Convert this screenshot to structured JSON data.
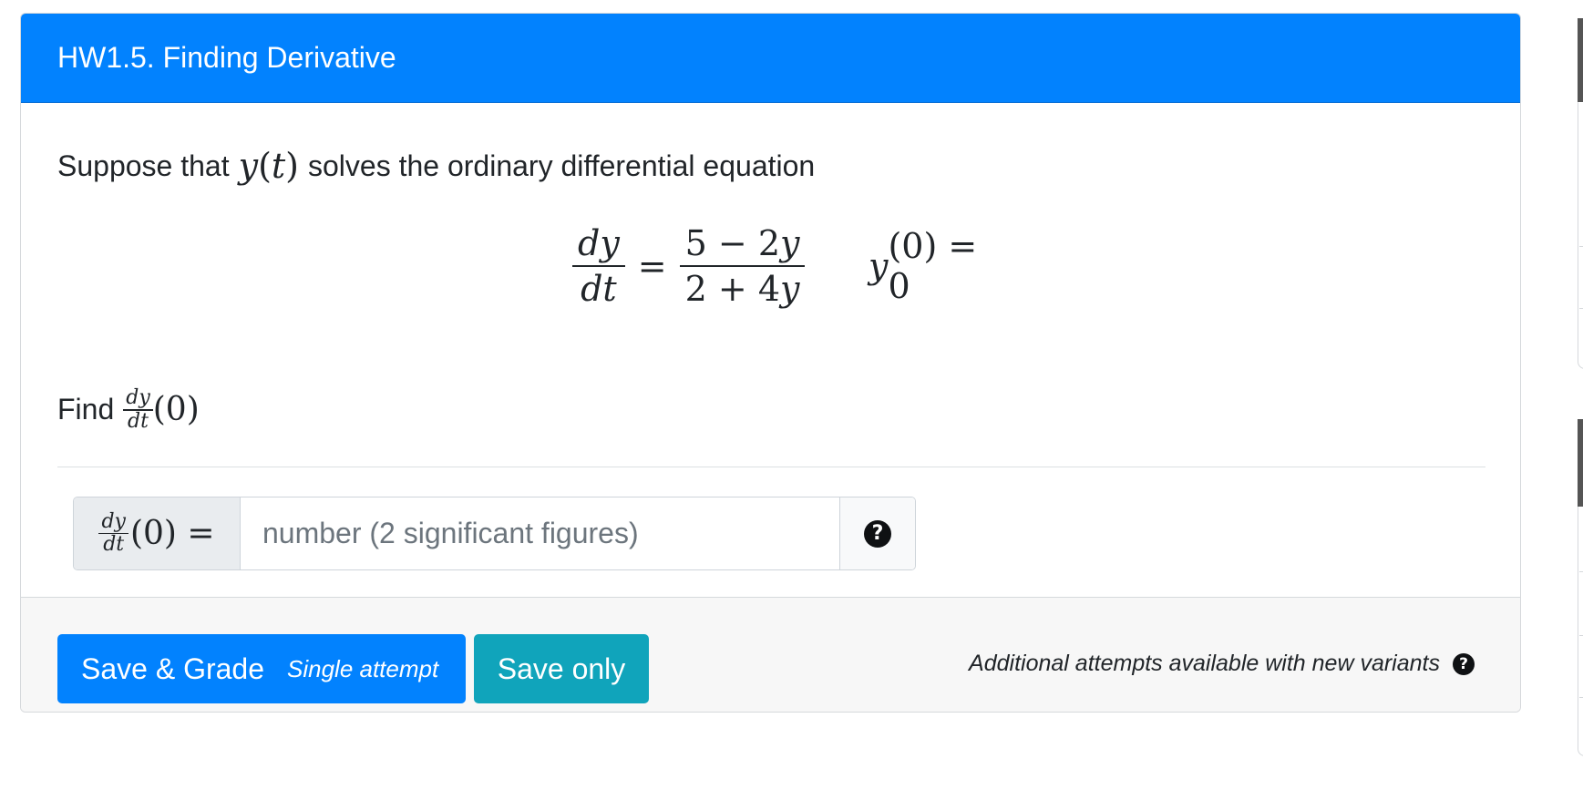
{
  "question": {
    "title": "HW1.5. Finding Derivative",
    "intro_before": "Suppose that",
    "intro_math_func": "y",
    "intro_math_paren_open": "(",
    "intro_math_var": "t",
    "intro_math_paren_close": ")",
    "intro_after": "solves the ordinary differential equation",
    "equation": {
      "lhs_num": "dy",
      "lhs_den": "dt",
      "equals": "=",
      "rhs_num_a": "5 − 2",
      "rhs_num_b": "y",
      "rhs_den_a": "2 + 4",
      "rhs_den_b": "y",
      "ic_func": "y",
      "ic_rest": "(0) = 0"
    },
    "find_label": "Find",
    "find_num": "dy",
    "find_den": "dt",
    "find_arg": "(0)"
  },
  "answer": {
    "prefix_num": "dy",
    "prefix_den": "dt",
    "prefix_rest": "(0) =",
    "placeholder": "number (2 significant figures)",
    "help_icon": "question-circle-icon",
    "help_glyph": "?"
  },
  "footer": {
    "save_grade_label": "Save & Grade",
    "save_grade_sub": "Single attempt",
    "save_only_label": "Save only",
    "attempts_note": "Additional attempts available with new variants",
    "note_help_glyph": "?"
  },
  "colors": {
    "header_bg": "#0282fe",
    "primary_button": "#0282fe",
    "info_button": "#10a4bb"
  }
}
